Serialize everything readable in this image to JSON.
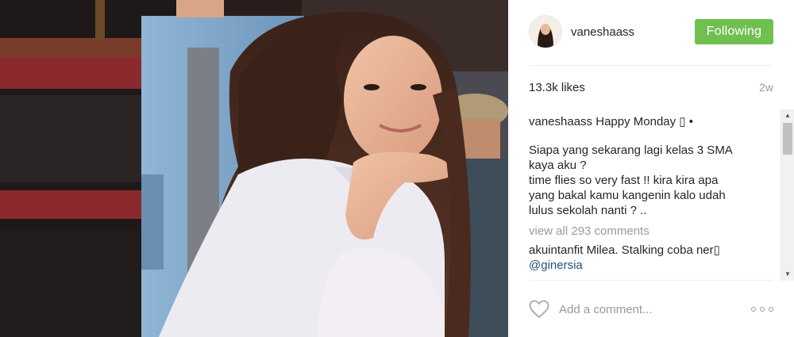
{
  "post": {
    "author": "vaneshaass",
    "follow_label": "Following",
    "likes": "13.3k likes",
    "age": "2w",
    "caption": {
      "username": "vaneshaass",
      "first_line": "Happy Monday ▯ •",
      "body": "Siapa yang sekarang lagi kelas 3 SMA\nkaya aku ?\ntime flies so very fast !! kira kira apa\nyang bakal kamu kangenin kalo udah\nlulus sekolah nanti ? .."
    },
    "view_all": "view all 293 comments",
    "comments": [
      {
        "username": "akuintanfit",
        "text": "Milea. Stalking coba ner▯",
        "mention": "@ginersia"
      }
    ],
    "comment_placeholder": "Add a comment...",
    "icons": {
      "like": "heart-outline-icon",
      "more": "more-options-icon",
      "scroll_up": "scroll-up-arrow-icon",
      "scroll_down": "scroll-down-arrow-icon"
    },
    "colors": {
      "follow_button": "#70c050",
      "mention": "#1f4f82",
      "muted_text": "#999999"
    }
  }
}
